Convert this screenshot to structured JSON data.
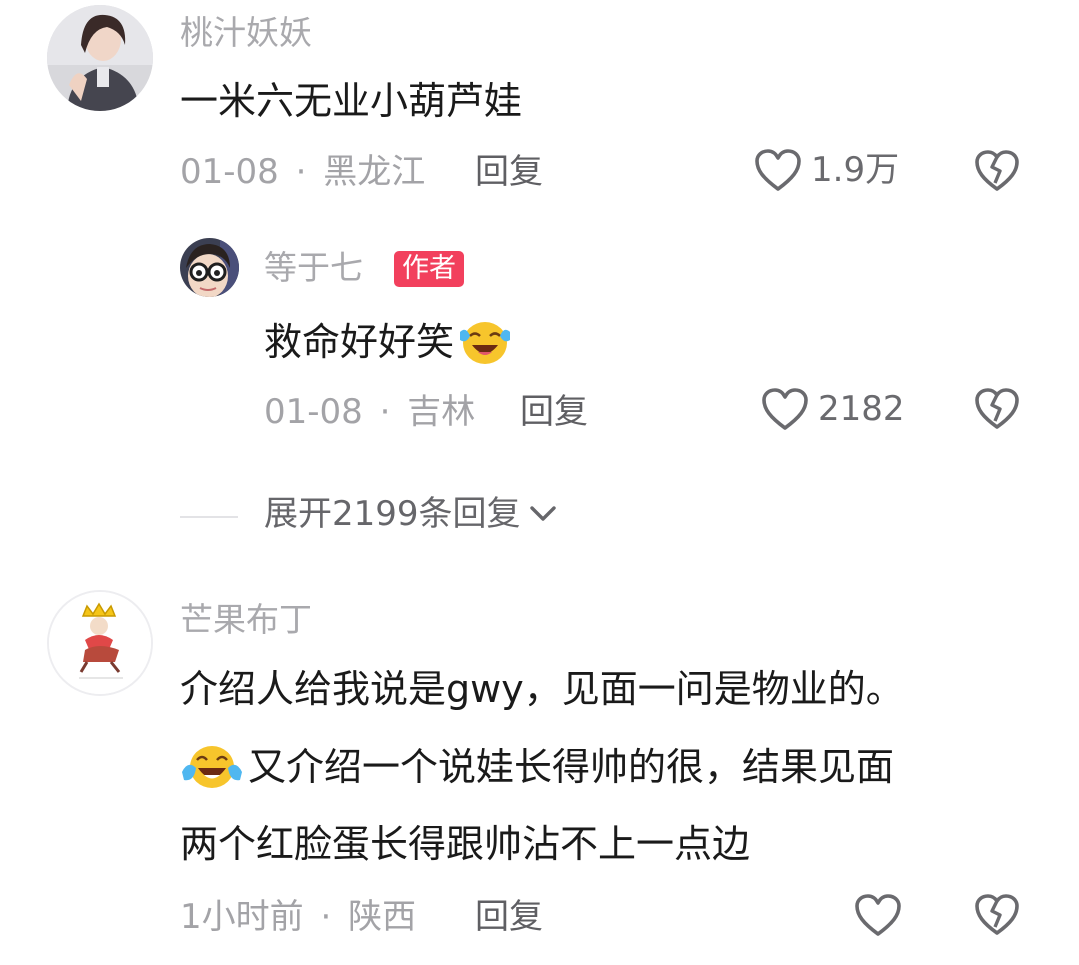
{
  "comments": [
    {
      "username": "桃汁妖妖",
      "text": "一米六无业小葫芦娃",
      "date": "01-08",
      "location": "黑龙江",
      "reply_label": "回复",
      "likes": "1.9万",
      "replies": [
        {
          "username": "等于七",
          "author_badge": "作者",
          "text": "救命好好笑",
          "date": "01-08",
          "location": "吉林",
          "reply_label": "回复",
          "likes": "2182"
        }
      ],
      "expand_label": "展开2199条回复"
    },
    {
      "username": "芒果布丁",
      "text_lines": [
        "介绍人给我说是gwy，见面一问是物业的。",
        "又介绍一个说娃长得帅的很，结果见面",
        "两个红脸蛋长得跟帅沾不上一点边"
      ],
      "date": "1小时前",
      "location": "陕西",
      "reply_label": "回复",
      "likes": ""
    }
  ],
  "separator": "·",
  "icons": {
    "like": "heart-outline-icon",
    "dislike": "broken-heart-icon",
    "expand": "chevron-down-icon",
    "emoji_laugh": "laughing-tears-emoji",
    "emoji_crying": "crying-laughing-emoji"
  },
  "colors": {
    "badge_bg": "#f2405d",
    "username": "#a9a9ad",
    "text": "#1a1a1a",
    "meta": "#a3a3a7"
  }
}
